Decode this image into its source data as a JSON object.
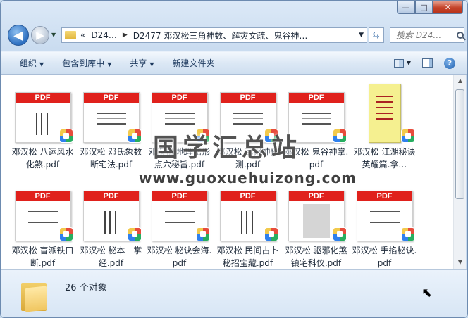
{
  "window": {
    "minimize": "—",
    "maximize": "□",
    "close": "✕"
  },
  "nav": {
    "back": "◀",
    "forward": "▶",
    "breadcrumb_prefix": "«",
    "breadcrumb": [
      "D24…",
      "D2477 邓汉松三角神数、解灾文疏、鬼谷神…"
    ],
    "search_placeholder": "搜索 D24…"
  },
  "toolbar": {
    "organize": "组织",
    "include_library": "包含到库中",
    "share": "共享",
    "new_folder": "新建文件夹"
  },
  "files": [
    {
      "name": "邓汉松 八运风水化煞.pdf",
      "thumb": "vertical"
    },
    {
      "name": "邓汉松 邓氏象数断宅法.pdf",
      "thumb": "lines"
    },
    {
      "name": "邓汉松 地理峦形点穴秘旨.pdf",
      "thumb": "lines"
    },
    {
      "name": "邓汉松 耳报神预测.pdf",
      "thumb": "title"
    },
    {
      "name": "邓汉松 鬼谷神掌.pdf",
      "thumb": "lines"
    },
    {
      "name": "邓汉松 江湖秘诀 英耀篇.拿…",
      "thumb": "tall"
    },
    {
      "name": "邓汉松 盲派铁口断.pdf",
      "thumb": "lines"
    },
    {
      "name": "邓汉松 秘本一掌经.pdf",
      "thumb": "vertical"
    },
    {
      "name": "邓汉松 秘诀会海.pdf",
      "thumb": "lines"
    },
    {
      "name": "邓汉松 民间占卜秘招宝藏.pdf",
      "thumb": "vertical"
    },
    {
      "name": "邓汉松 驱邪化煞镇宅科仪.pdf",
      "thumb": "gray"
    },
    {
      "name": "邓汉松 手掐秘诀.pdf",
      "thumb": "lines"
    }
  ],
  "pdf_label": "PDF",
  "watermark": {
    "cn": "国学汇总站",
    "url": "www.guoxuehuizong.com"
  },
  "status": {
    "count": "26 个对象"
  }
}
